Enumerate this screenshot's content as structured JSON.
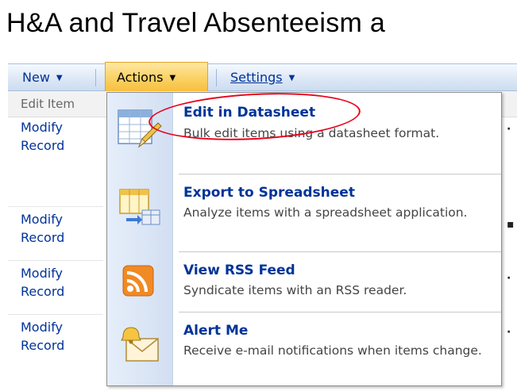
{
  "page": {
    "title": "H&A and Travel Absenteeism a"
  },
  "toolbar": {
    "new_label": "New",
    "actions_label": "Actions",
    "settings_label": "Settings"
  },
  "list": {
    "header_edit": "Edit Item",
    "rows": [
      {
        "line1": "Modify",
        "line2": "Record"
      },
      {
        "line1": "Modify",
        "line2": "Record"
      },
      {
        "line1": "Modify",
        "line2": "Record"
      },
      {
        "line1": "Modify",
        "line2": "Record"
      }
    ]
  },
  "menu": {
    "items": [
      {
        "title": "Edit in Datasheet",
        "desc": "Bulk edit items using a datasheet format.",
        "icon": "datasheet-edit-icon"
      },
      {
        "title": "Export to Spreadsheet",
        "desc": "Analyze items with a spreadsheet application.",
        "icon": "spreadsheet-export-icon"
      },
      {
        "title": "View RSS Feed",
        "desc": "Syndicate items with an RSS reader.",
        "icon": "rss-feed-icon"
      },
      {
        "title": "Alert Me",
        "desc": "Receive e-mail notifications when items change.",
        "icon": "alert-bell-icon"
      }
    ]
  },
  "colors": {
    "link_blue": "#003399",
    "actions_highlight": "#fbd36a",
    "annotation_red": "#e8001c"
  }
}
